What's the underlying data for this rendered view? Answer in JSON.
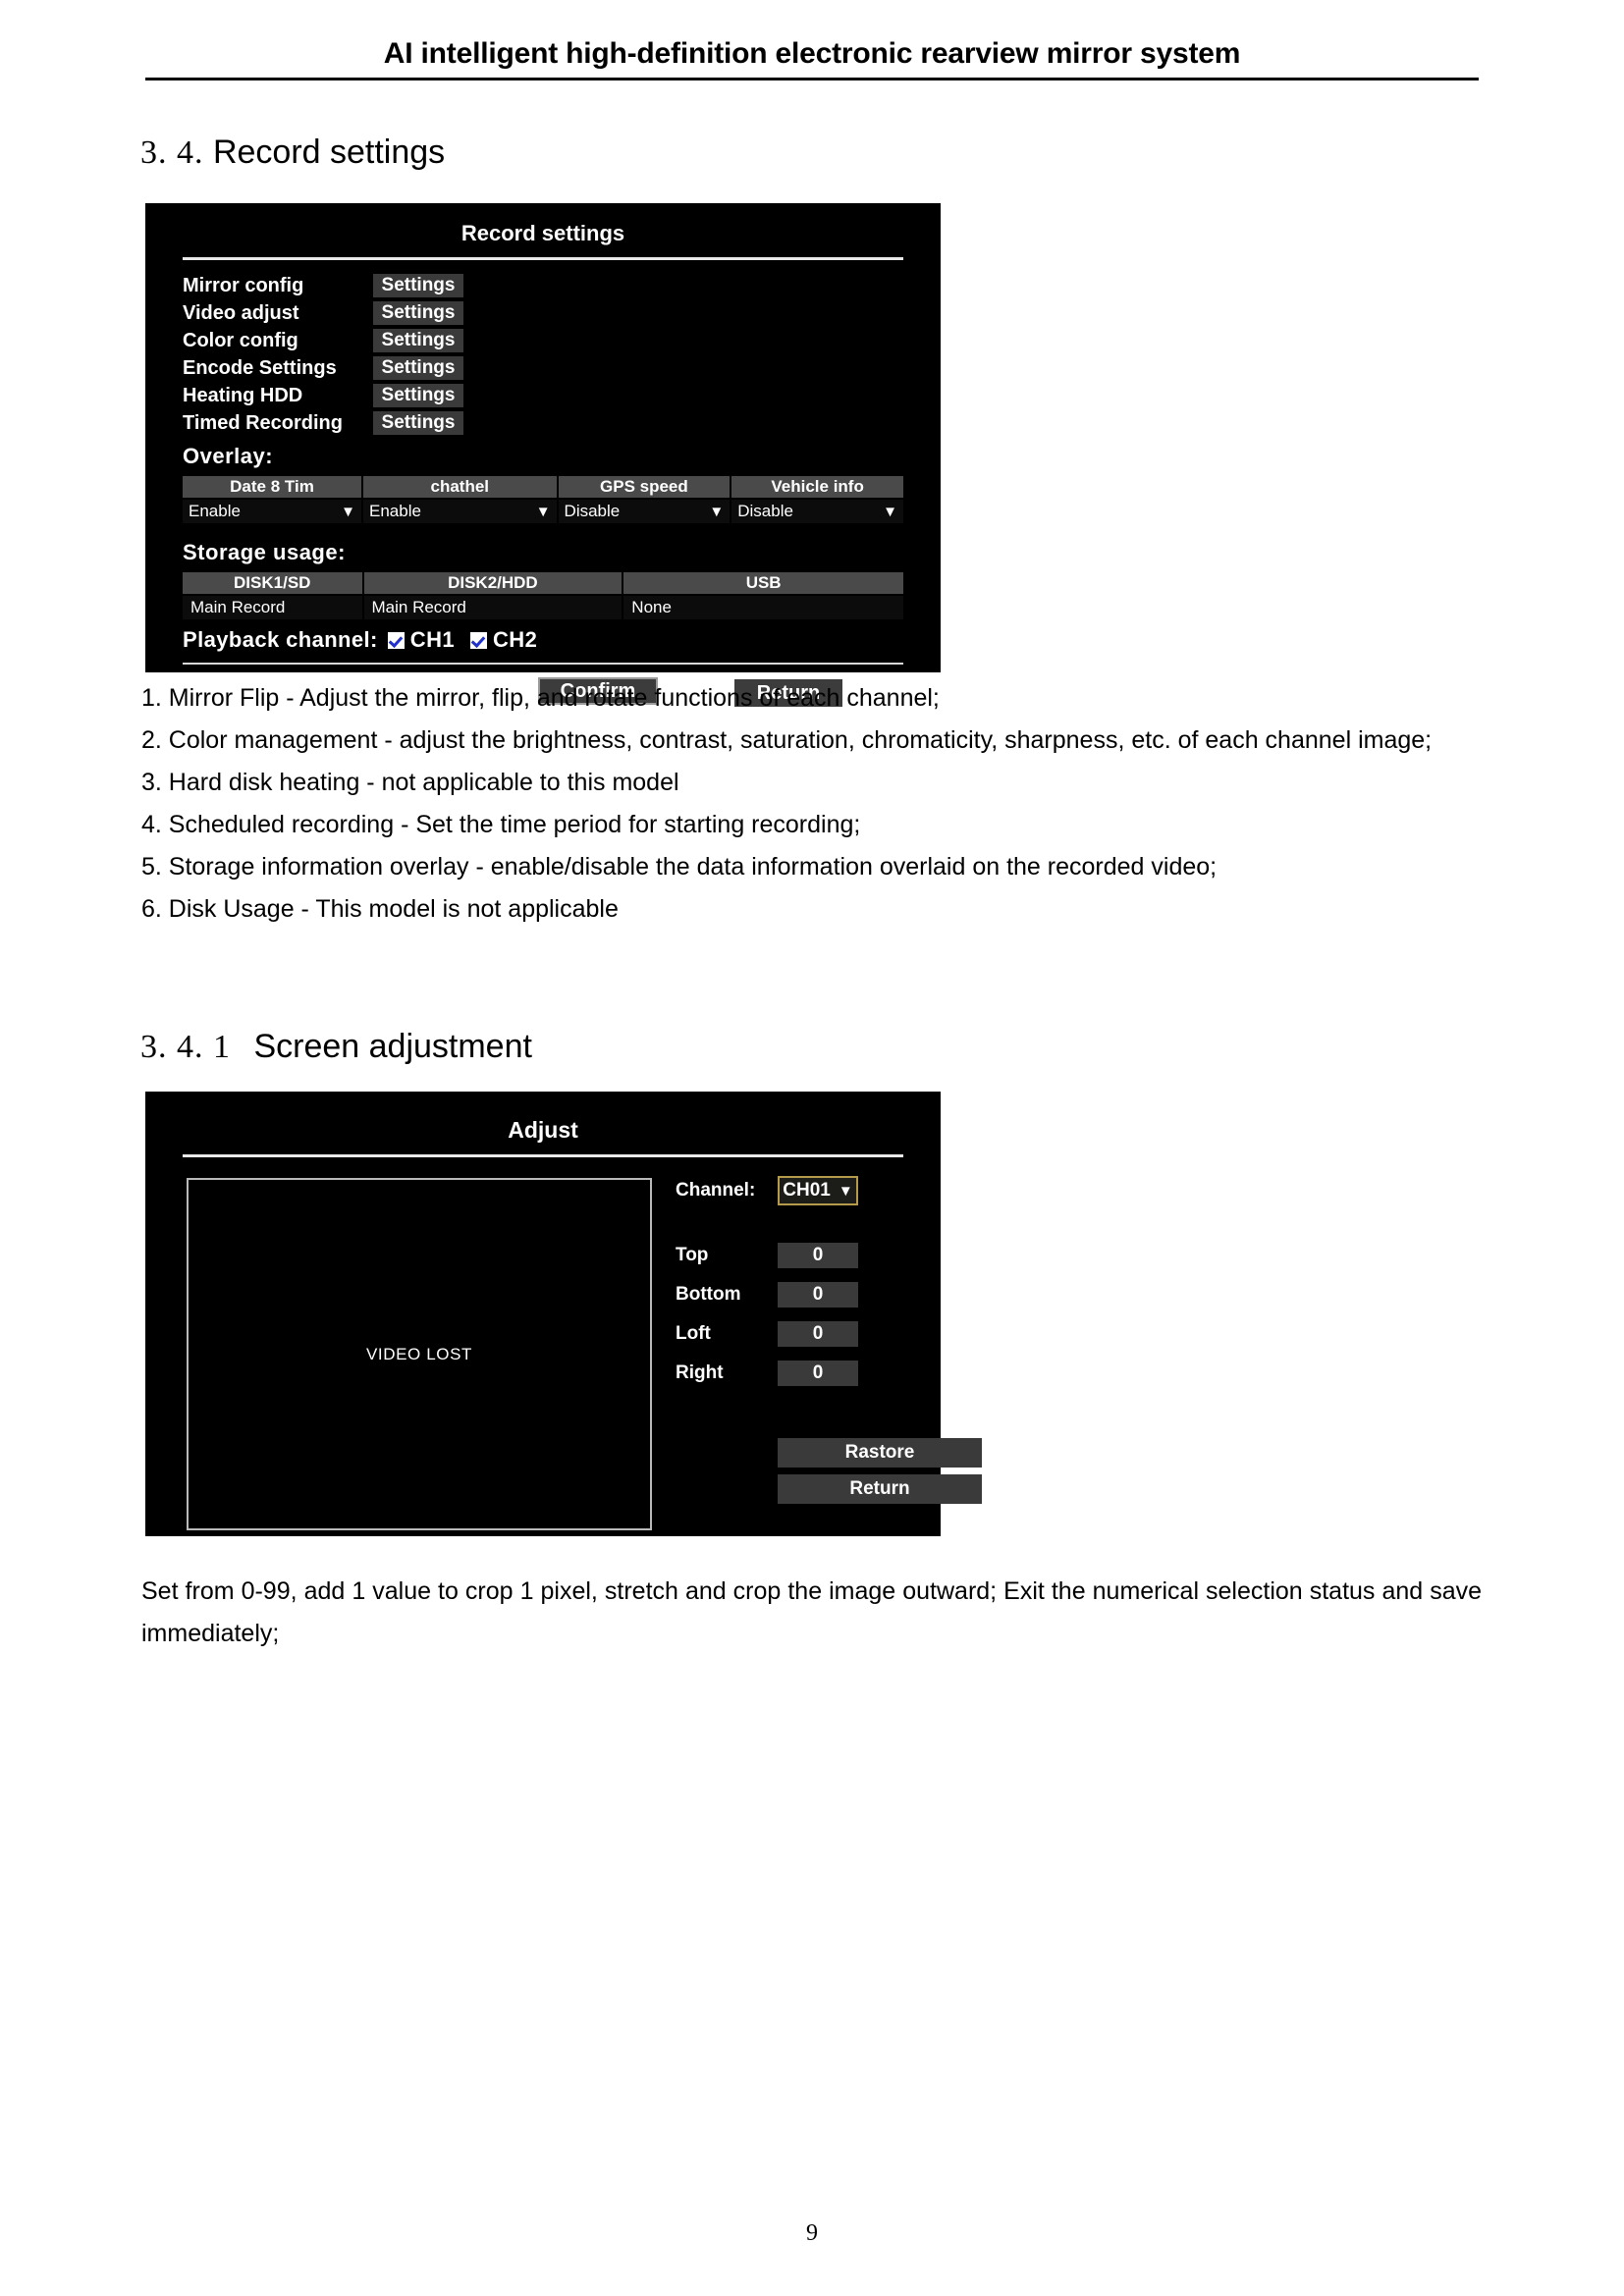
{
  "header": {
    "title": "AI intelligent high-definition electronic rearview mirror system"
  },
  "sections": {
    "record": {
      "number": "3. 4.",
      "title": "Record settings"
    },
    "screen": {
      "number": "3. 4. 1",
      "title": "Screen adjustment"
    }
  },
  "record_panel": {
    "title": "Record settings",
    "menu_items": [
      {
        "label": "Mirror config",
        "button": "Settings"
      },
      {
        "label": "Video adjust",
        "button": "Settings"
      },
      {
        "label": "Color config",
        "button": "Settings"
      },
      {
        "label": "Encode Settings",
        "button": "Settings"
      },
      {
        "label": "Heating HDD",
        "button": "Settings"
      },
      {
        "label": "Timed Recording",
        "button": "Settings"
      }
    ],
    "overlay": {
      "label": "Overlay:",
      "headers": [
        "Date 8 Tim",
        "chathel",
        "GPS speed",
        "Vehicle info"
      ],
      "values": [
        "Enable",
        "Enable",
        "Disable",
        "Disable"
      ],
      "caret": "▼"
    },
    "storage": {
      "label": "Storage usage:",
      "headers": [
        "DISK1/SD",
        "DISK2/HDD",
        "USB"
      ],
      "values": [
        "Main Record",
        "Main Record",
        "None"
      ]
    },
    "playback": {
      "label": "Playback channel:",
      "channels": [
        "CH1",
        "CH2"
      ]
    },
    "buttons": {
      "confirm": "Confirm",
      "return": "Return"
    }
  },
  "record_notes": [
    "1. Mirror Flip - Adjust the mirror, flip, and rotate functions of each channel;",
    "2. Color management - adjust the brightness, contrast, saturation, chromaticity, sharpness, etc. of each channel image;",
    "3. Hard disk heating - not applicable to this model",
    "4. Scheduled recording - Set the time period for starting recording;",
    "5. Storage information overlay - enable/disable the data information overlaid on the recorded video;",
    "6. Disk Usage - This model is not applicable"
  ],
  "adjust_panel": {
    "title": "Adjust",
    "video_status": "VIDEO LOST",
    "channel": {
      "label": "Channel:",
      "value": "CH01",
      "caret": "▼"
    },
    "fields": [
      {
        "label": "Top",
        "value": "0"
      },
      {
        "label": "Bottom",
        "value": "0"
      },
      {
        "label": "Loft",
        "value": "0"
      },
      {
        "label": "Right",
        "value": "0"
      }
    ],
    "buttons": {
      "restore": "Rastore",
      "return": "Return"
    }
  },
  "adjust_note": "Set from 0-99, add 1 value to crop 1 pixel, stretch and crop the image outward; Exit the numerical selection status and save immediately;",
  "page_number": "9",
  "colors": {
    "panel_background": "#000000",
    "button_face": "#3a3a3a",
    "table_header": "#4a4a4a",
    "highlight_border": "#b69a4c",
    "checkbox_check": "#2030c8"
  }
}
